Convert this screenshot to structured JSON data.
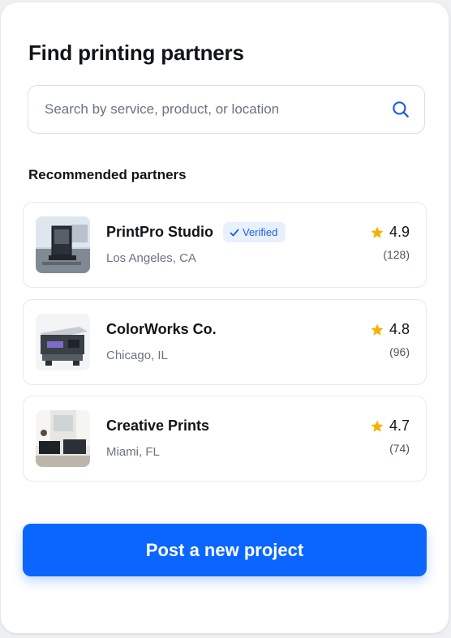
{
  "page": {
    "title": "Find printing partners",
    "search": {
      "placeholder": "Search by service, product, or location",
      "value": ""
    },
    "section_title": "Recommended partners",
    "cta_label": "Post a new project"
  },
  "partners": [
    {
      "name": "PrintPro Studio",
      "location": "Los Angeles, CA",
      "rating": "4.9",
      "reviews": "(128)",
      "verified_label": "Verified",
      "thumbnail_icon": "3d-printer-image"
    },
    {
      "name": "ColorWorks Co.",
      "location": "Chicago, IL",
      "rating": "4.8",
      "reviews": "(96)",
      "thumbnail_icon": "inkjet-printer-image"
    },
    {
      "name": "Creative Prints",
      "location": "Miami, FL",
      "rating": "4.7",
      "reviews": "(74)",
      "thumbnail_icon": "print-studio-image"
    }
  ],
  "colors": {
    "accent": "#0a66ff",
    "star": "#f5b301",
    "verified_bg": "#e8f0fe",
    "verified_text": "#1d5fdc"
  }
}
